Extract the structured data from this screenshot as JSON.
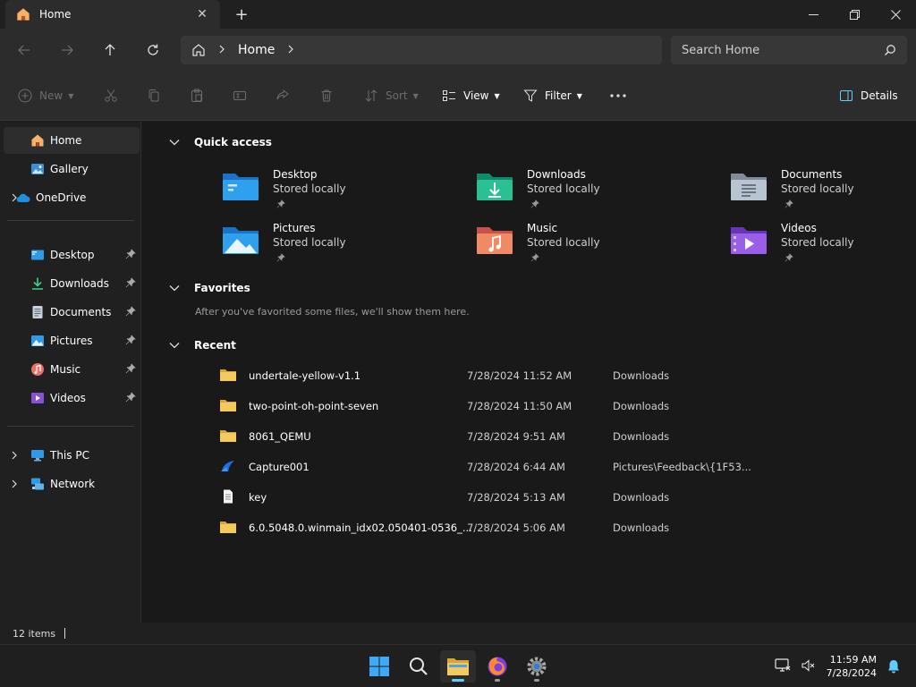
{
  "window": {
    "tab_title": "Home",
    "tab_close_icon": "close-icon",
    "new_tab_icon": "plus-icon"
  },
  "address": {
    "home_icon": "home-icon",
    "path": "Home",
    "search_placeholder": "Search Home"
  },
  "toolbar": {
    "new_label": "New",
    "sort_label": "Sort",
    "view_label": "View",
    "filter_label": "Filter",
    "details_label": "Details"
  },
  "sidebar": {
    "top": [
      {
        "label": "Home",
        "icon": "home-icon",
        "selected": true
      },
      {
        "label": "Gallery",
        "icon": "gallery-icon"
      },
      {
        "label": "OneDrive",
        "icon": "cloud-icon"
      }
    ],
    "pinned": [
      {
        "label": "Desktop",
        "icon": "desktop-icon"
      },
      {
        "label": "Downloads",
        "icon": "download-icon"
      },
      {
        "label": "Documents",
        "icon": "document-icon"
      },
      {
        "label": "Pictures",
        "icon": "picture-icon"
      },
      {
        "label": "Music",
        "icon": "music-icon"
      },
      {
        "label": "Videos",
        "icon": "video-icon"
      }
    ],
    "bottom": [
      {
        "label": "This PC",
        "icon": "computer-icon"
      },
      {
        "label": "Network",
        "icon": "network-icon"
      }
    ]
  },
  "main": {
    "quick_access": {
      "title": "Quick access",
      "items": [
        {
          "name": "Desktop",
          "sub": "Stored locally",
          "icon": "desktop-folder-icon"
        },
        {
          "name": "Downloads",
          "sub": "Stored locally",
          "icon": "downloads-folder-icon"
        },
        {
          "name": "Documents",
          "sub": "Stored locally",
          "icon": "documents-folder-icon"
        },
        {
          "name": "Pictures",
          "sub": "Stored locally",
          "icon": "pictures-folder-icon"
        },
        {
          "name": "Music",
          "sub": "Stored locally",
          "icon": "music-folder-icon"
        },
        {
          "name": "Videos",
          "sub": "Stored locally",
          "icon": "videos-folder-icon"
        }
      ]
    },
    "favorites": {
      "title": "Favorites",
      "empty_text": "After you've favorited some files, we'll show them here."
    },
    "recent": {
      "title": "Recent",
      "rows": [
        {
          "name": "undertale-yellow-v1.1",
          "date": "7/28/2024 11:52 AM",
          "location": "Downloads",
          "icon": "folder-icon"
        },
        {
          "name": "two-point-oh-point-seven",
          "date": "7/28/2024 11:50 AM",
          "location": "Downloads",
          "icon": "folder-icon"
        },
        {
          "name": "8061_QEMU",
          "date": "7/28/2024 9:51 AM",
          "location": "Downloads",
          "icon": "folder-icon"
        },
        {
          "name": "Capture001",
          "date": "7/28/2024 6:44 AM",
          "location": "Pictures\\Feedback\\{1F53...",
          "icon": "image-file-icon"
        },
        {
          "name": "key",
          "date": "7/28/2024 5:13 AM",
          "location": "Downloads",
          "icon": "text-file-icon"
        },
        {
          "name": "6.0.5048.0.winmain_idx02.050401-0536_...",
          "date": "7/28/2024 5:06 AM",
          "location": "Downloads",
          "icon": "folder-icon"
        }
      ]
    }
  },
  "status": {
    "items_count": "12 items"
  },
  "taskbar": {
    "time": "11:59 AM",
    "date": "7/28/2024"
  },
  "colors": {
    "accent": "#60cdff",
    "folder_yellow": "#f4c95d",
    "selected_bg": "#2d2d2d"
  }
}
